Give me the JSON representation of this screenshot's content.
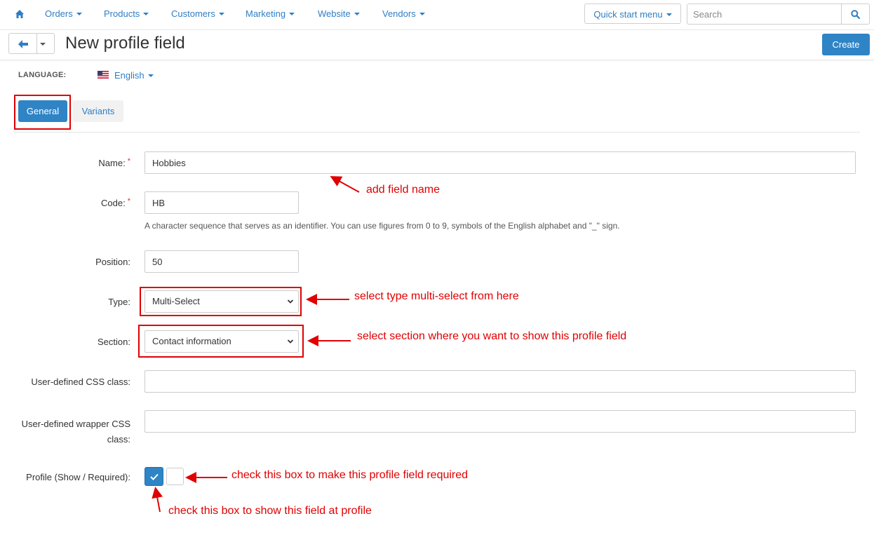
{
  "nav": {
    "items": [
      {
        "label": "Orders"
      },
      {
        "label": "Products"
      },
      {
        "label": "Customers"
      },
      {
        "label": "Marketing"
      },
      {
        "label": "Website"
      },
      {
        "label": "Vendors"
      }
    ],
    "quick_start": "Quick start menu",
    "search_placeholder": "Search"
  },
  "page": {
    "title": "New profile field",
    "create_label": "Create"
  },
  "language": {
    "label": "LANGUAGE:",
    "value": "English"
  },
  "tabs": [
    {
      "label": "General",
      "active": true
    },
    {
      "label": "Variants",
      "active": false
    }
  ],
  "form": {
    "name": {
      "label": "Name:",
      "required": "*",
      "value": "Hobbies"
    },
    "code": {
      "label": "Code:",
      "required": "*",
      "value": "HB",
      "help": "A character sequence that serves as an identifier. You can use figures from 0 to 9, symbols of the English alphabet and \"_\" sign."
    },
    "position": {
      "label": "Position:",
      "value": "50"
    },
    "type": {
      "label": "Type:",
      "value": "Multi-Select"
    },
    "section": {
      "label": "Section:",
      "value": "Contact information"
    },
    "css_class": {
      "label": "User-defined CSS class:",
      "value": ""
    },
    "wrapper_css": {
      "label_line1": "User-defined wrapper CSS",
      "label_line2": "class:",
      "value": ""
    },
    "profile": {
      "label": "Profile (Show / Required):",
      "show_checked": true,
      "required_checked": false
    }
  },
  "annotations": {
    "name_note": "add field name",
    "type_note": "select type multi-select from here",
    "section_note": "select section where you want to show this profile field",
    "required_note": "check this box to make this profile field required",
    "show_note": "check this box to show this field at profile"
  },
  "colors": {
    "accent": "#2f84c6",
    "link": "#2f7ec4",
    "annotation": "#e00000"
  }
}
